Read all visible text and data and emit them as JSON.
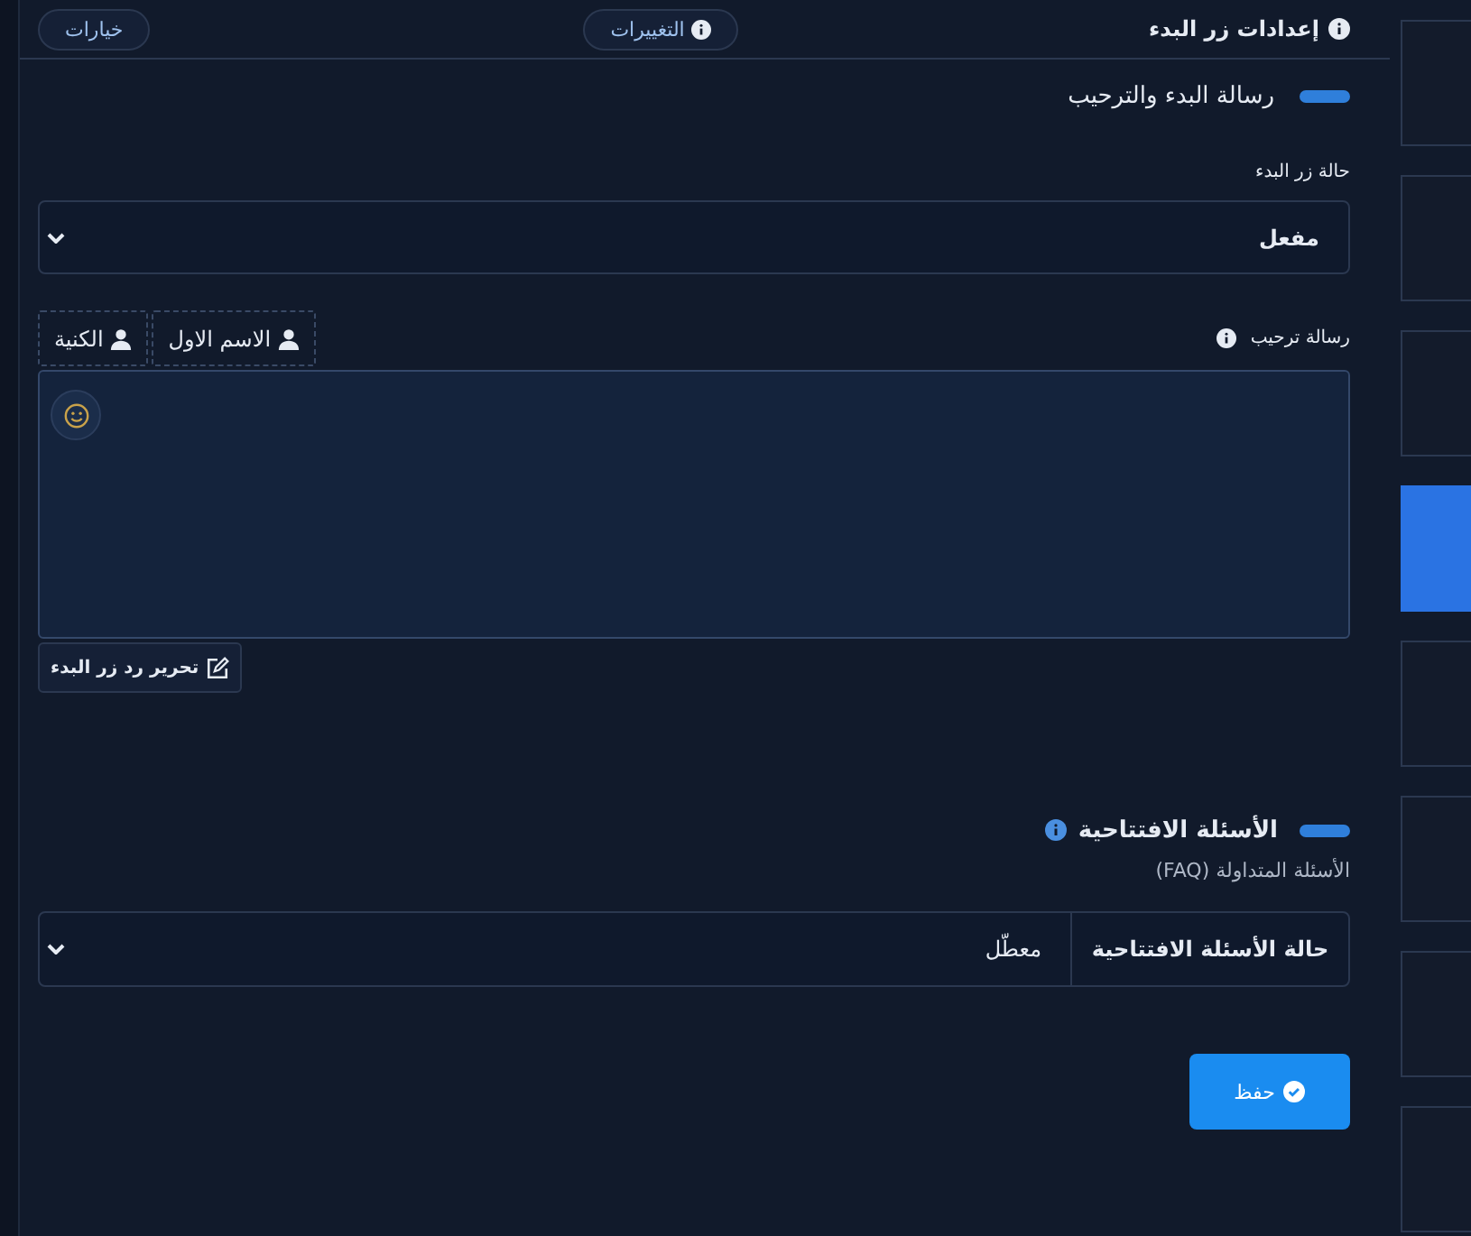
{
  "top_bar": {
    "title": "إعدادات زر البدء",
    "changes_button": "التغييرات",
    "options_button": "خيارات"
  },
  "welcome_section": {
    "title": "رسالة البدء والترحيب",
    "status_label": "حالة زر البدء",
    "status_value": "مفعل",
    "message_label": "رسالة ترحيب",
    "variables": [
      "الاسم الاول",
      "الكنية"
    ],
    "edit_button": "تحرير رد زر البدء"
  },
  "faq_section": {
    "title": "الأسئلة الافتتاحية",
    "subtitle": "الأسئلة المتداولة (FAQ)",
    "status_label": "حالة الأسئلة الافتتاحية",
    "status_value": "معطّل"
  },
  "save_button": "حفظ",
  "side_tabs": [
    {
      "selected": false
    },
    {
      "selected": false
    },
    {
      "selected": false
    },
    {
      "selected": true
    },
    {
      "selected": false
    },
    {
      "selected": false
    },
    {
      "selected": false
    },
    {
      "selected": false
    }
  ]
}
